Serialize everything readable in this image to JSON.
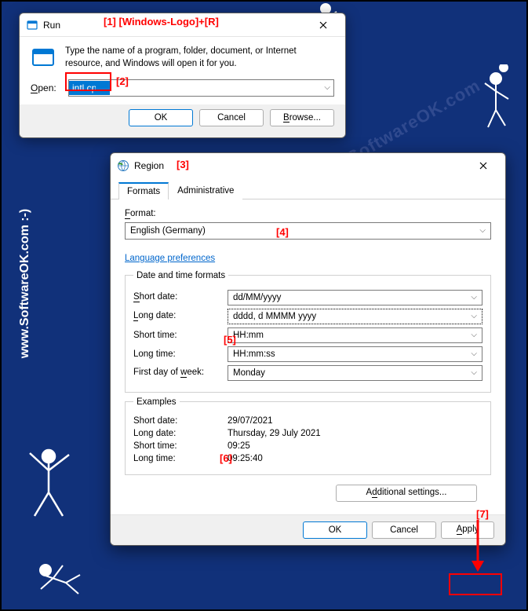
{
  "watermark_text": "SoftwareOK.com",
  "side_text": "www.SoftwareOK.com :-)",
  "annotations": {
    "a1": "[1]  [Windows-Logo]+[R]",
    "a2": "[2]",
    "a3": "[3]",
    "a4": "[4]",
    "a5": "[5]",
    "a6": "[6]",
    "a7": "[7]"
  },
  "run": {
    "title": "Run",
    "body": "Type the name of a program, folder, document, or Internet resource, and Windows will open it for you.",
    "open_label_pre": "O",
    "open_label_post": "pen:",
    "value": "intl.cpl",
    "ok": "OK",
    "cancel": "Cancel",
    "browse_pre": "B",
    "browse_post": "rowse..."
  },
  "region": {
    "title": "Region",
    "close_x": "✕",
    "tab_formats": "Formats",
    "tab_admin": "Administrative",
    "format_label_pre": "F",
    "format_label_post": "ormat:",
    "format_value": "English (Germany)",
    "lang_prefs": "Language preferences",
    "fs_date_time": "Date and time formats",
    "short_date_lbl_pre": "S",
    "short_date_lbl_post": "hort date:",
    "short_date_val": "dd/MM/yyyy",
    "long_date_lbl_pre": "L",
    "long_date_lbl_post": "ong date:",
    "long_date_val": "dddd, d MMMM yyyy",
    "short_time_lbl": "Short time:",
    "short_time_val": "HH:mm",
    "long_time_lbl": "Long time:",
    "long_time_val": "HH:mm:ss",
    "first_day_lbl_pre": "First day of ",
    "first_day_lbl_u": "w",
    "first_day_lbl_post": "eek:",
    "first_day_val": "Monday",
    "fs_examples": "Examples",
    "ex_sd_lbl": "Short date:",
    "ex_sd_val": "29/07/2021",
    "ex_ld_lbl": "Long date:",
    "ex_ld_val": "Thursday, 29 July 2021",
    "ex_st_lbl": "Short time:",
    "ex_st_val": "09:25",
    "ex_lt_lbl": "Long time:",
    "ex_lt_val": "09:25:40",
    "additional_pre": "A",
    "additional_u": "d",
    "additional_post": "ditional settings...",
    "ok": "OK",
    "cancel": "Cancel",
    "apply_pre": "A",
    "apply_post": "pply"
  }
}
